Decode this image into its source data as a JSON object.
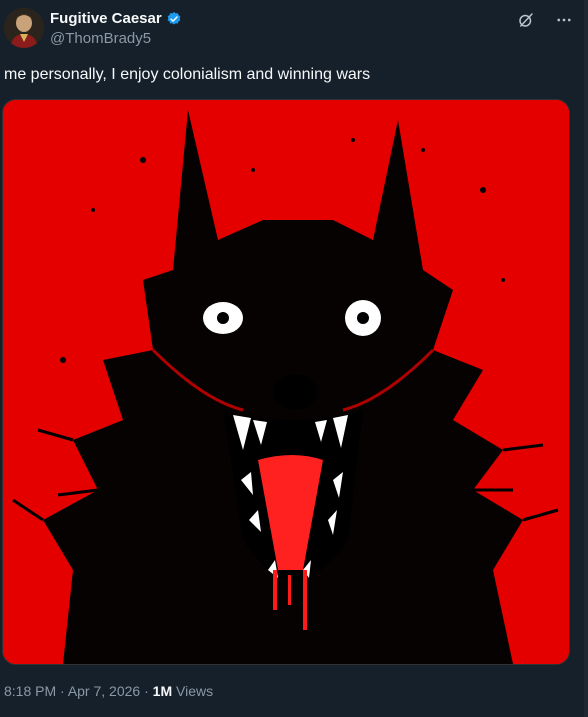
{
  "author": {
    "display_name": "Fugitive Caesar",
    "handle": "@ThomBrady5",
    "verified": true
  },
  "tweet": {
    "text": "me personally, I enjoy colonialism and winning wars"
  },
  "meta": {
    "time": "8:18 PM",
    "sep1": " · ",
    "date": "Apr 7, 2026",
    "sep2": " · ",
    "views_count": "1M",
    "views_label": " Views"
  },
  "icons": {
    "grok": "grok-icon",
    "more": "more-icon",
    "verified": "verified-badge-icon"
  },
  "colors": {
    "background": "#15202b",
    "media_background": "#e80000",
    "verified": "#1d9bf0",
    "muted": "#8b98a5"
  }
}
